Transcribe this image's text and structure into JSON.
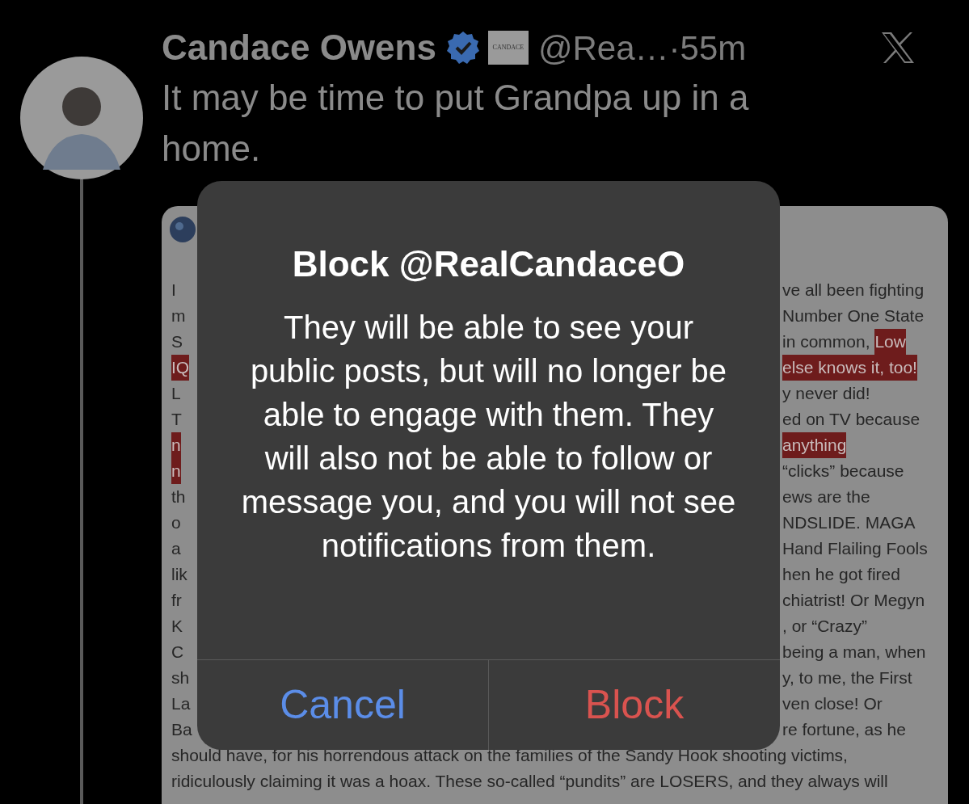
{
  "tweet": {
    "author": "Candace Owens",
    "verified": true,
    "affiliate_badge": "CANDACE",
    "handle": "@Rea…",
    "separator": "·",
    "time": "55m",
    "text": "It may be time to put Grandpa up in a home."
  },
  "attached_image": {
    "lines": [
      {
        "kind": "split",
        "left": {
          "text": "I",
          "highlighted": false
        },
        "right": [
          {
            "text": "ve all been fighting",
            "highlighted": false
          }
        ]
      },
      {
        "kind": "split",
        "left": {
          "text": "m",
          "highlighted": false
        },
        "right": [
          {
            "text": "Number One State",
            "highlighted": false
          }
        ]
      },
      {
        "kind": "split",
        "left": {
          "text": "S",
          "highlighted": false
        },
        "right": [
          {
            "text": "in common, ",
            "highlighted": false
          },
          {
            "text": "Low",
            "highlighted": true
          }
        ]
      },
      {
        "kind": "split",
        "left": {
          "text": "IQ",
          "highlighted": true
        },
        "right": [
          {
            "text": "else knows it, too!",
            "highlighted": true
          }
        ]
      },
      {
        "kind": "split",
        "left": {
          "text": "L",
          "highlighted": false
        },
        "right": [
          {
            "text": "y never did!",
            "highlighted": false
          }
        ]
      },
      {
        "kind": "split",
        "left": {
          "text": "T",
          "highlighted": false
        },
        "right": [
          {
            "text": "ed on TV because",
            "highlighted": false
          }
        ]
      },
      {
        "kind": "split",
        "left": {
          "text": "n",
          "highlighted": true
        },
        "right": [
          {
            "text": "anything",
            "highlighted": true
          }
        ]
      },
      {
        "kind": "split",
        "left": {
          "text": "n",
          "highlighted": true
        },
        "right": [
          {
            "text": "“clicks” because",
            "highlighted": false
          }
        ]
      },
      {
        "kind": "split",
        "left": {
          "text": "th",
          "highlighted": false
        },
        "right": [
          {
            "text": "ews are the",
            "highlighted": false
          }
        ]
      },
      {
        "kind": "split",
        "left": {
          "text": "o",
          "highlighted": false
        },
        "right": [
          {
            "text": "NDSLIDE. MAGA",
            "highlighted": false
          }
        ]
      },
      {
        "kind": "split",
        "left": {
          "text": "a",
          "highlighted": false
        },
        "right": [
          {
            "text": "Hand Flailing Fools",
            "highlighted": false
          }
        ]
      },
      {
        "kind": "split",
        "left": {
          "text": "lik",
          "highlighted": false
        },
        "right": [
          {
            "text": "hen he got fired",
            "highlighted": false
          }
        ]
      },
      {
        "kind": "split",
        "left": {
          "text": "fr",
          "highlighted": false
        },
        "right": [
          {
            "text": "chiatrist! Or Megyn",
            "highlighted": false
          }
        ]
      },
      {
        "kind": "split",
        "left": {
          "text": "K",
          "highlighted": false
        },
        "right": [
          {
            "text": ", or “Crazy”",
            "highlighted": false
          }
        ]
      },
      {
        "kind": "split",
        "left": {
          "text": "C",
          "highlighted": false
        },
        "right": [
          {
            "text": "being a man, when",
            "highlighted": false
          }
        ]
      },
      {
        "kind": "split",
        "left": {
          "text": "sh",
          "highlighted": false
        },
        "right": [
          {
            "text": "y, to me, the First",
            "highlighted": false
          }
        ]
      },
      {
        "kind": "split",
        "left": {
          "text": "La",
          "highlighted": false
        },
        "right": [
          {
            "text": "ven close! Or",
            "highlighted": false
          }
        ]
      },
      {
        "kind": "split",
        "left": {
          "text": "Ba",
          "highlighted": false
        },
        "right": [
          {
            "text": "re fortune, as he",
            "highlighted": false
          }
        ]
      },
      {
        "kind": "full",
        "text": "should have, for his horrendous attack on the families of the Sandy Hook shooting victims,"
      },
      {
        "kind": "full",
        "text": "ridiculously claiming it was a hoax. These so-called “pundits” are LOSERS, and they always will"
      }
    ]
  },
  "dialog": {
    "title": "Block @RealCandaceO",
    "message": "They will be able to see your public posts, but will no longer be able to engage with them. They will also not be able to follow or message you, and you will not see notifications from them.",
    "buttons": [
      {
        "label": "Cancel",
        "kind": "cancel"
      },
      {
        "label": "Block",
        "kind": "destructive"
      }
    ]
  }
}
